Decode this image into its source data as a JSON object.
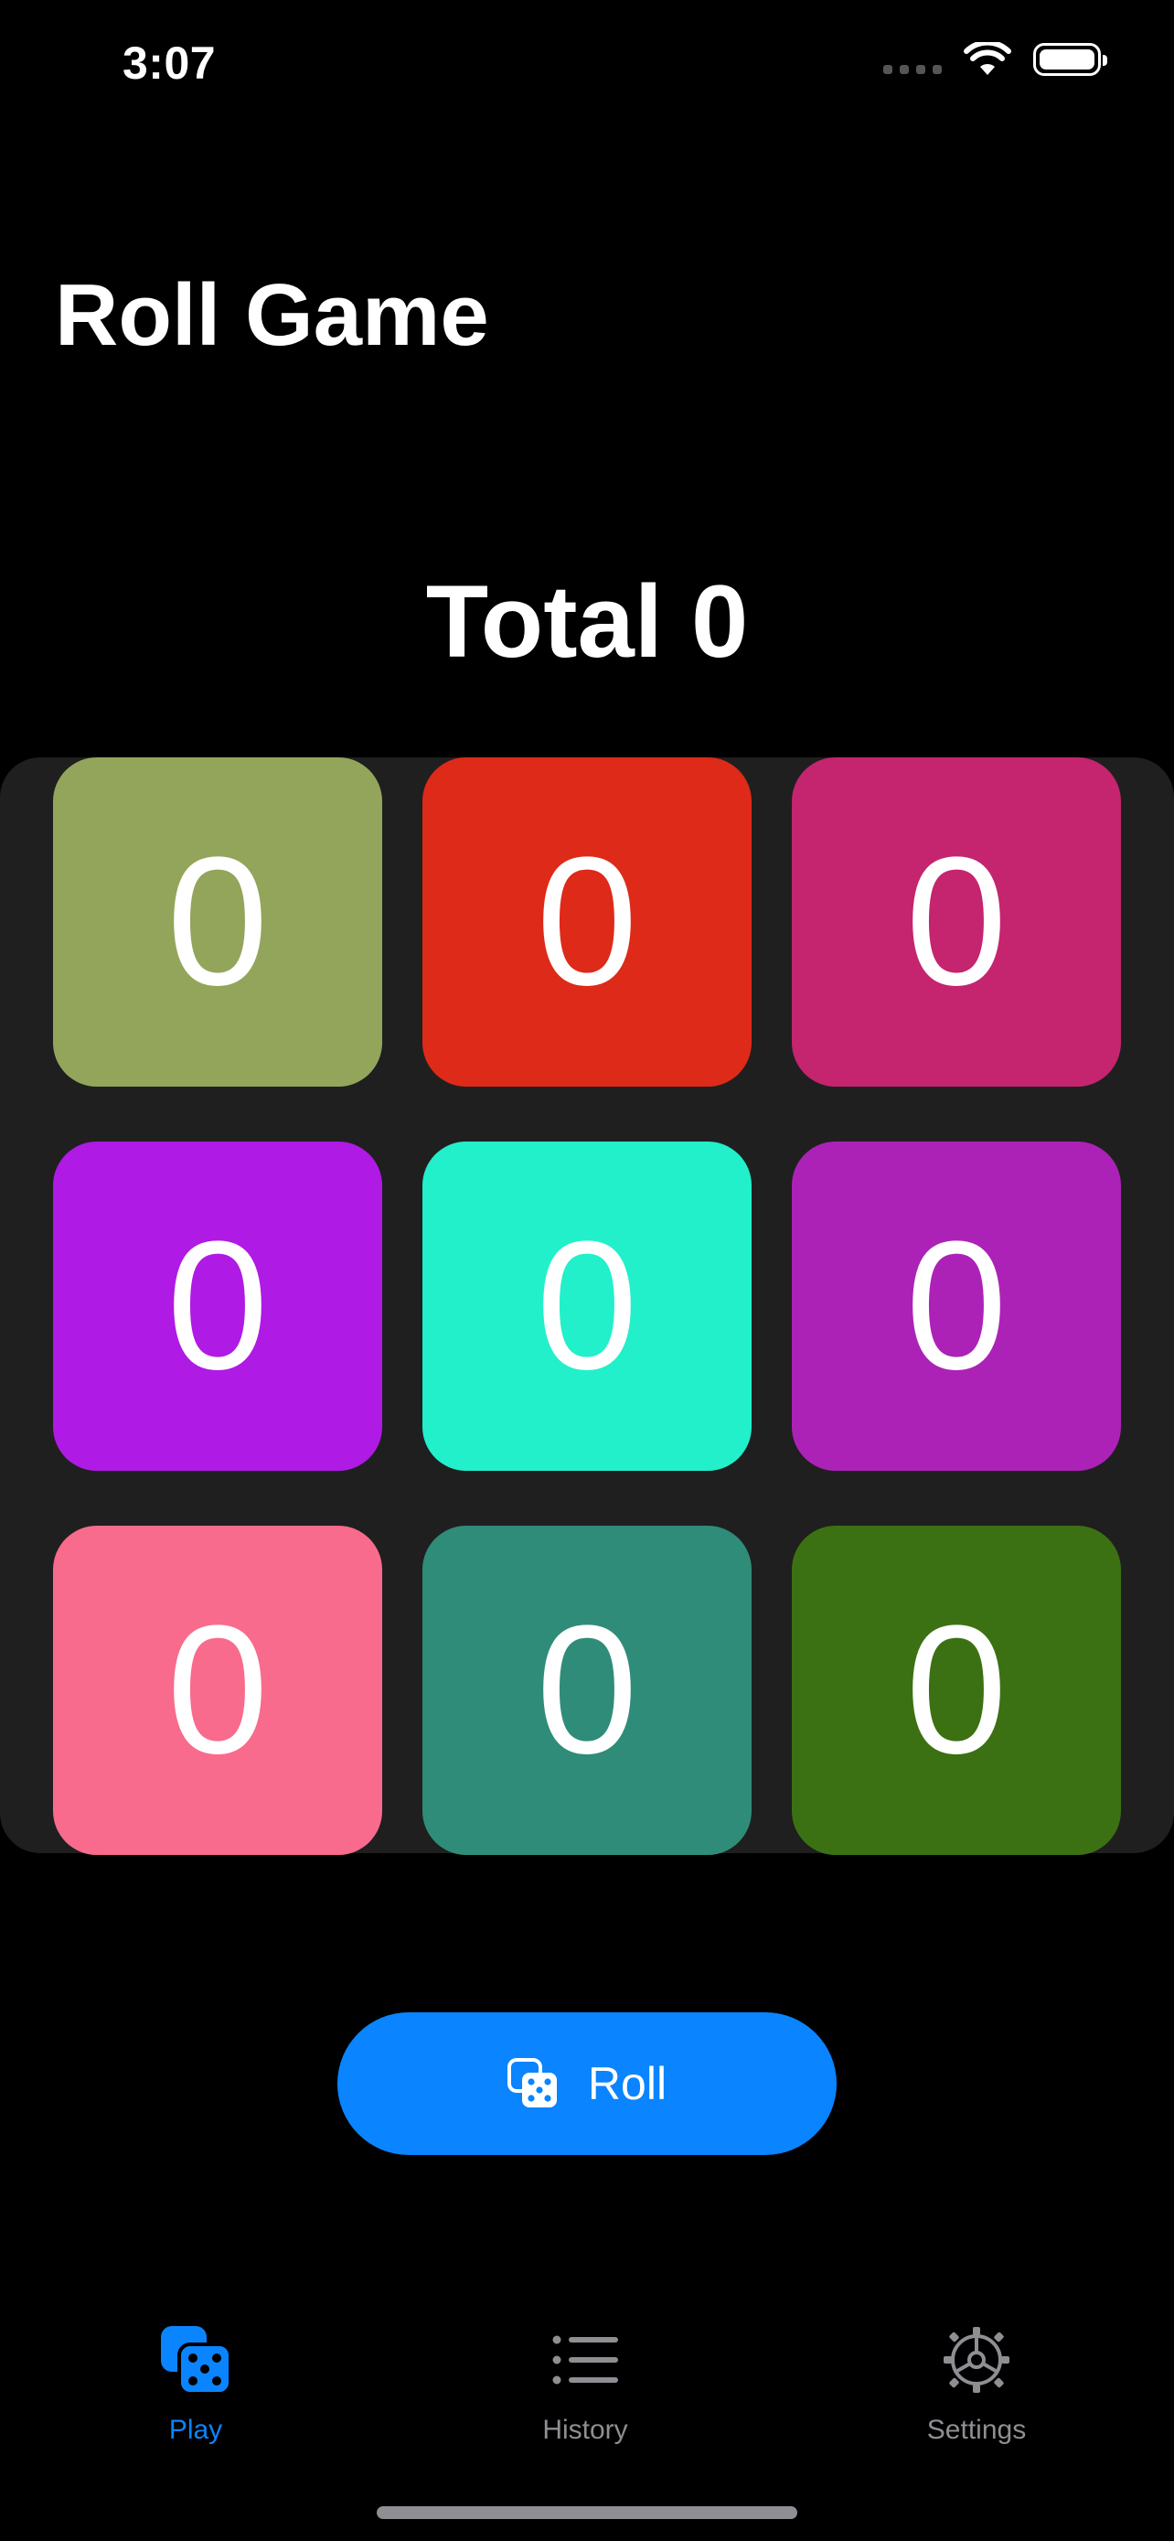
{
  "status_bar": {
    "time": "3:07"
  },
  "app": {
    "title": "Roll Game"
  },
  "total": {
    "label": "Total 0"
  },
  "dice": [
    {
      "value": "0",
      "color": "#93a55a"
    },
    {
      "value": "0",
      "color": "#de2a18"
    },
    {
      "value": "0",
      "color": "#c5246e"
    },
    {
      "value": "0",
      "color": "#af1ae4"
    },
    {
      "value": "0",
      "color": "#21f0ca"
    },
    {
      "value": "0",
      "color": "#ac22b7"
    },
    {
      "value": "0",
      "color": "#f86b8c"
    },
    {
      "value": "0",
      "color": "#2f8c78"
    },
    {
      "value": "0",
      "color": "#3b7113"
    }
  ],
  "roll_button": {
    "label": "Roll",
    "icon": "dice-icon"
  },
  "tabs": [
    {
      "label": "Play",
      "icon": "dice-icon",
      "active": true
    },
    {
      "label": "History",
      "icon": "list-icon",
      "active": false
    },
    {
      "label": "Settings",
      "icon": "gear-icon",
      "active": false
    }
  ]
}
